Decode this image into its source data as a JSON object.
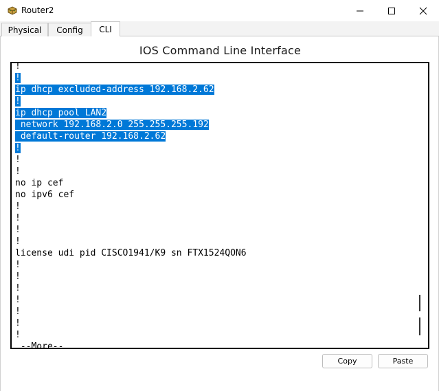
{
  "window": {
    "title": "Router2",
    "icon": "router-icon",
    "controls": [
      "minimize-icon",
      "maximize-icon",
      "close-icon"
    ]
  },
  "tabs": [
    {
      "label": "Physical",
      "active": false
    },
    {
      "label": "Config",
      "active": false
    },
    {
      "label": "CLI",
      "active": true
    }
  ],
  "main": {
    "heading": "IOS Command Line Interface"
  },
  "terminal": {
    "selection_color": "#0078d7",
    "lines": [
      {
        "text": "!",
        "selected": false
      },
      {
        "text": "!",
        "selected": true
      },
      {
        "text": "ip dhcp excluded-address 192.168.2.62",
        "selected": true
      },
      {
        "text": "!",
        "selected": true
      },
      {
        "text": "ip dhcp pool LAN2",
        "selected": true
      },
      {
        "text": " network 192.168.2.0 255.255.255.192",
        "selected": true
      },
      {
        "text": " default-router 192.168.2.62",
        "selected": true
      },
      {
        "text": "!",
        "selected": true
      },
      {
        "text": "!",
        "selected": false
      },
      {
        "text": "!",
        "selected": false
      },
      {
        "text": "no ip cef",
        "selected": false
      },
      {
        "text": "no ipv6 cef",
        "selected": false
      },
      {
        "text": "!",
        "selected": false
      },
      {
        "text": "!",
        "selected": false
      },
      {
        "text": "!",
        "selected": false
      },
      {
        "text": "!",
        "selected": false
      },
      {
        "text": "license udi pid CISCO1941/K9 sn FTX1524QON6",
        "selected": false
      },
      {
        "text": "!",
        "selected": false
      },
      {
        "text": "!",
        "selected": false
      },
      {
        "text": "!",
        "selected": false
      },
      {
        "text": "!",
        "selected": false
      },
      {
        "text": "!",
        "selected": false
      },
      {
        "text": "!",
        "selected": false
      },
      {
        "text": "!",
        "selected": false
      },
      {
        "text": " --More--",
        "selected": false
      }
    ]
  },
  "buttons": {
    "copy": "Copy",
    "paste": "Paste"
  }
}
